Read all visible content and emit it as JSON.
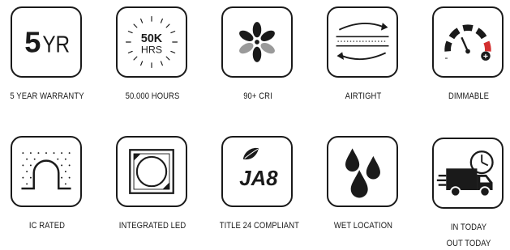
{
  "features": [
    {
      "label": "5 YEAR WARRANTY",
      "icon": "warranty-5yr-icon",
      "badge": {
        "big": "5",
        "small": "YR"
      }
    },
    {
      "label": "50.000 HOURS",
      "icon": "hours-50k-icon",
      "badge": {
        "top": "50K",
        "bottom": "HRS"
      }
    },
    {
      "label": "90+ CRI",
      "icon": "cri-flower-icon"
    },
    {
      "label": "AIRTIGHT",
      "icon": "airtight-arrows-icon"
    },
    {
      "label": "DIMMABLE",
      "icon": "dimmer-gauge-icon",
      "gauge": {
        "minus": "-",
        "plus": "+"
      }
    },
    {
      "label": "IC RATED",
      "icon": "ic-rated-insulation-icon"
    },
    {
      "label": "INTEGRATED LED",
      "icon": "integrated-led-chip-icon"
    },
    {
      "label": "TITLE 24 COMPLIANT",
      "icon": "ja8-leaf-icon",
      "badge": {
        "text": "JA8"
      }
    },
    {
      "label": "WET LOCATION",
      "icon": "water-drops-icon"
    },
    {
      "label_lines": [
        "IN TODAY",
        "OUT TODAY"
      ],
      "icon": "truck-clock-icon"
    }
  ],
  "colors": {
    "stroke": "#1a1a1a",
    "accent_red": "#d32f2f",
    "grey": "#9a9a9a"
  }
}
